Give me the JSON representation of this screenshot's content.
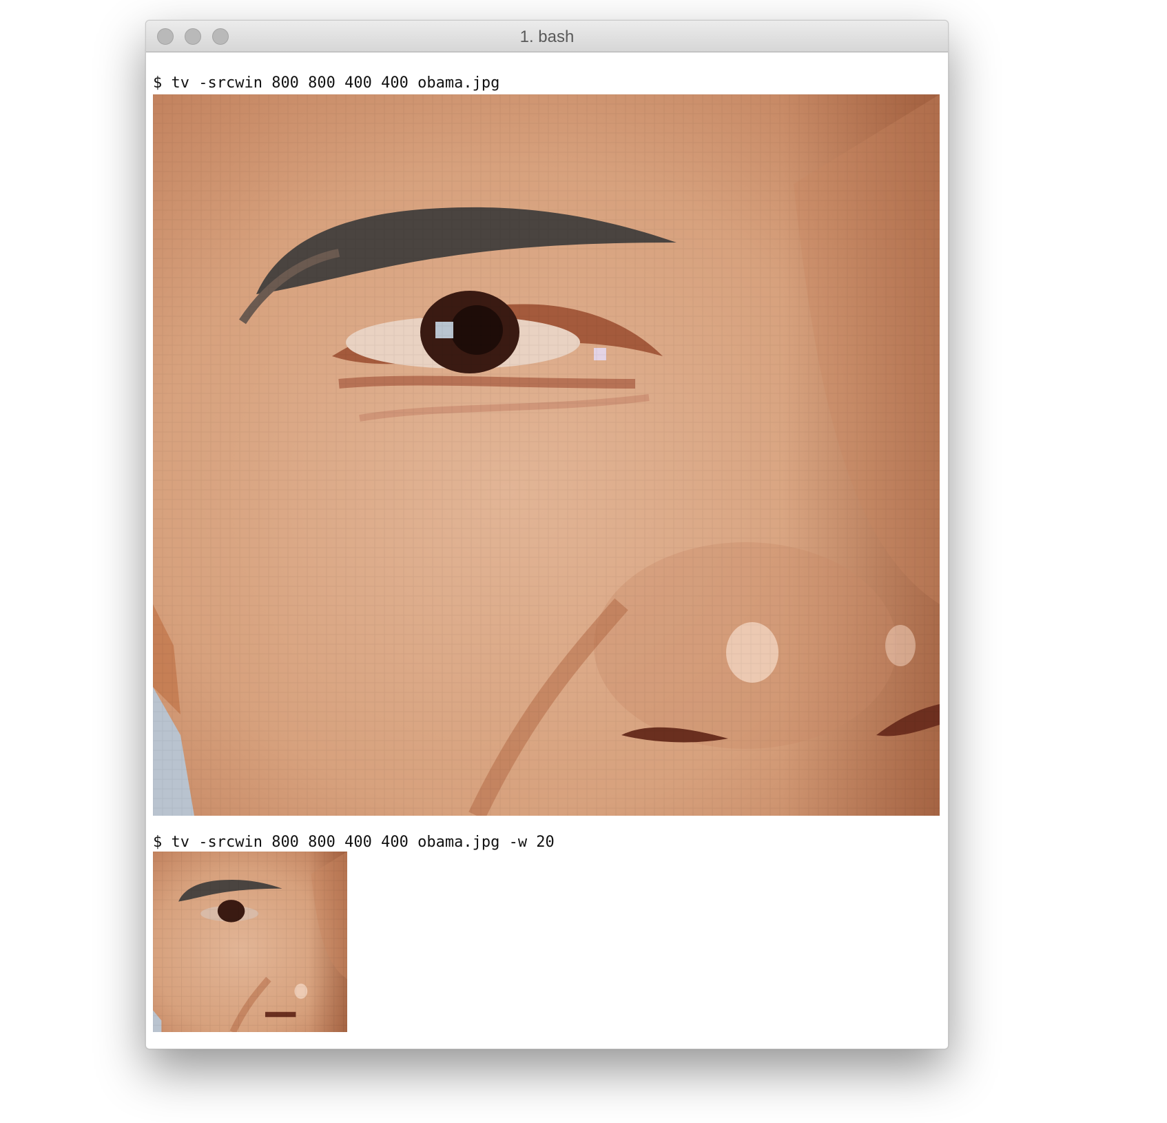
{
  "window": {
    "title": "1. bash"
  },
  "terminal": {
    "prompt_symbol": "$",
    "lines": [
      {
        "prompt": "$",
        "command": "tv -srcwin 800 800 400 400 obama.jpg"
      },
      {
        "prompt": "$",
        "command": "tv -srcwin 800 800 400 400 obama.jpg -w 20"
      }
    ],
    "final_prompt": "$"
  },
  "images": {
    "large": {
      "description_icon": "pixelated-face-closeup-image"
    },
    "small": {
      "description_icon": "pixelated-face-closeup-thumbnail"
    }
  },
  "colors": {
    "skin": "#d9a987",
    "skin_dark": "#b97a58",
    "brow": "#4a4440",
    "pupil": "#3a1a12"
  }
}
